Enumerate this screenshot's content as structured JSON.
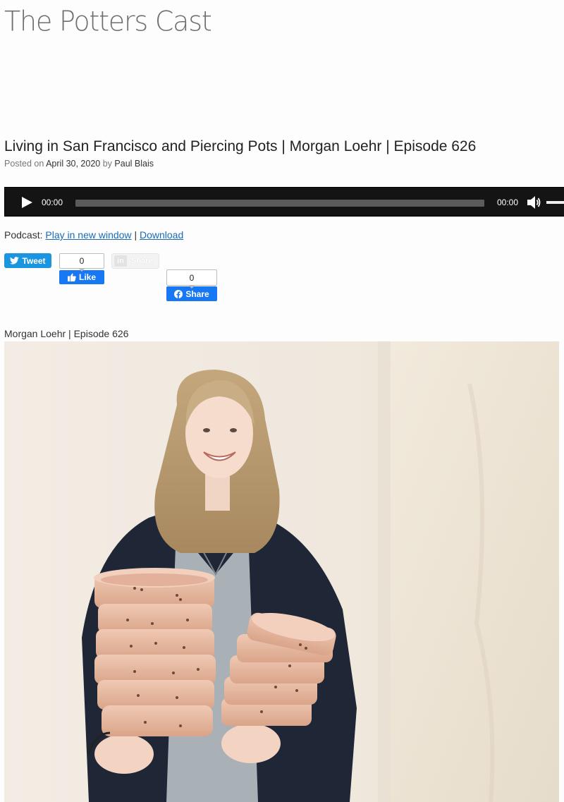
{
  "site": {
    "title": "The Potters Cast"
  },
  "post": {
    "title": "Living in San Francisco and Piercing Pots | Morgan Loehr | Episode 626",
    "meta_prefix": "Posted on",
    "date": "April 30, 2020",
    "meta_by": "by",
    "author": "Paul Blais"
  },
  "player": {
    "current_time": "00:00",
    "duration": "00:00",
    "progress": 0
  },
  "podcast": {
    "label": "Podcast:",
    "play_link": "Play in new window",
    "separator": "|",
    "download_link": "Download"
  },
  "share": {
    "tweet_label": "Tweet",
    "like_count": "0",
    "like_label": "Like",
    "linkedin_label": "Share",
    "fb_share_count": "0",
    "fb_share_label": "Share"
  },
  "content": {
    "caption": "Morgan Loehr | Episode 626"
  },
  "colors": {
    "link": "#1a6bb5",
    "player_bg": "#141414",
    "twitter": "#1b95e0",
    "facebook": "#1877f2"
  }
}
